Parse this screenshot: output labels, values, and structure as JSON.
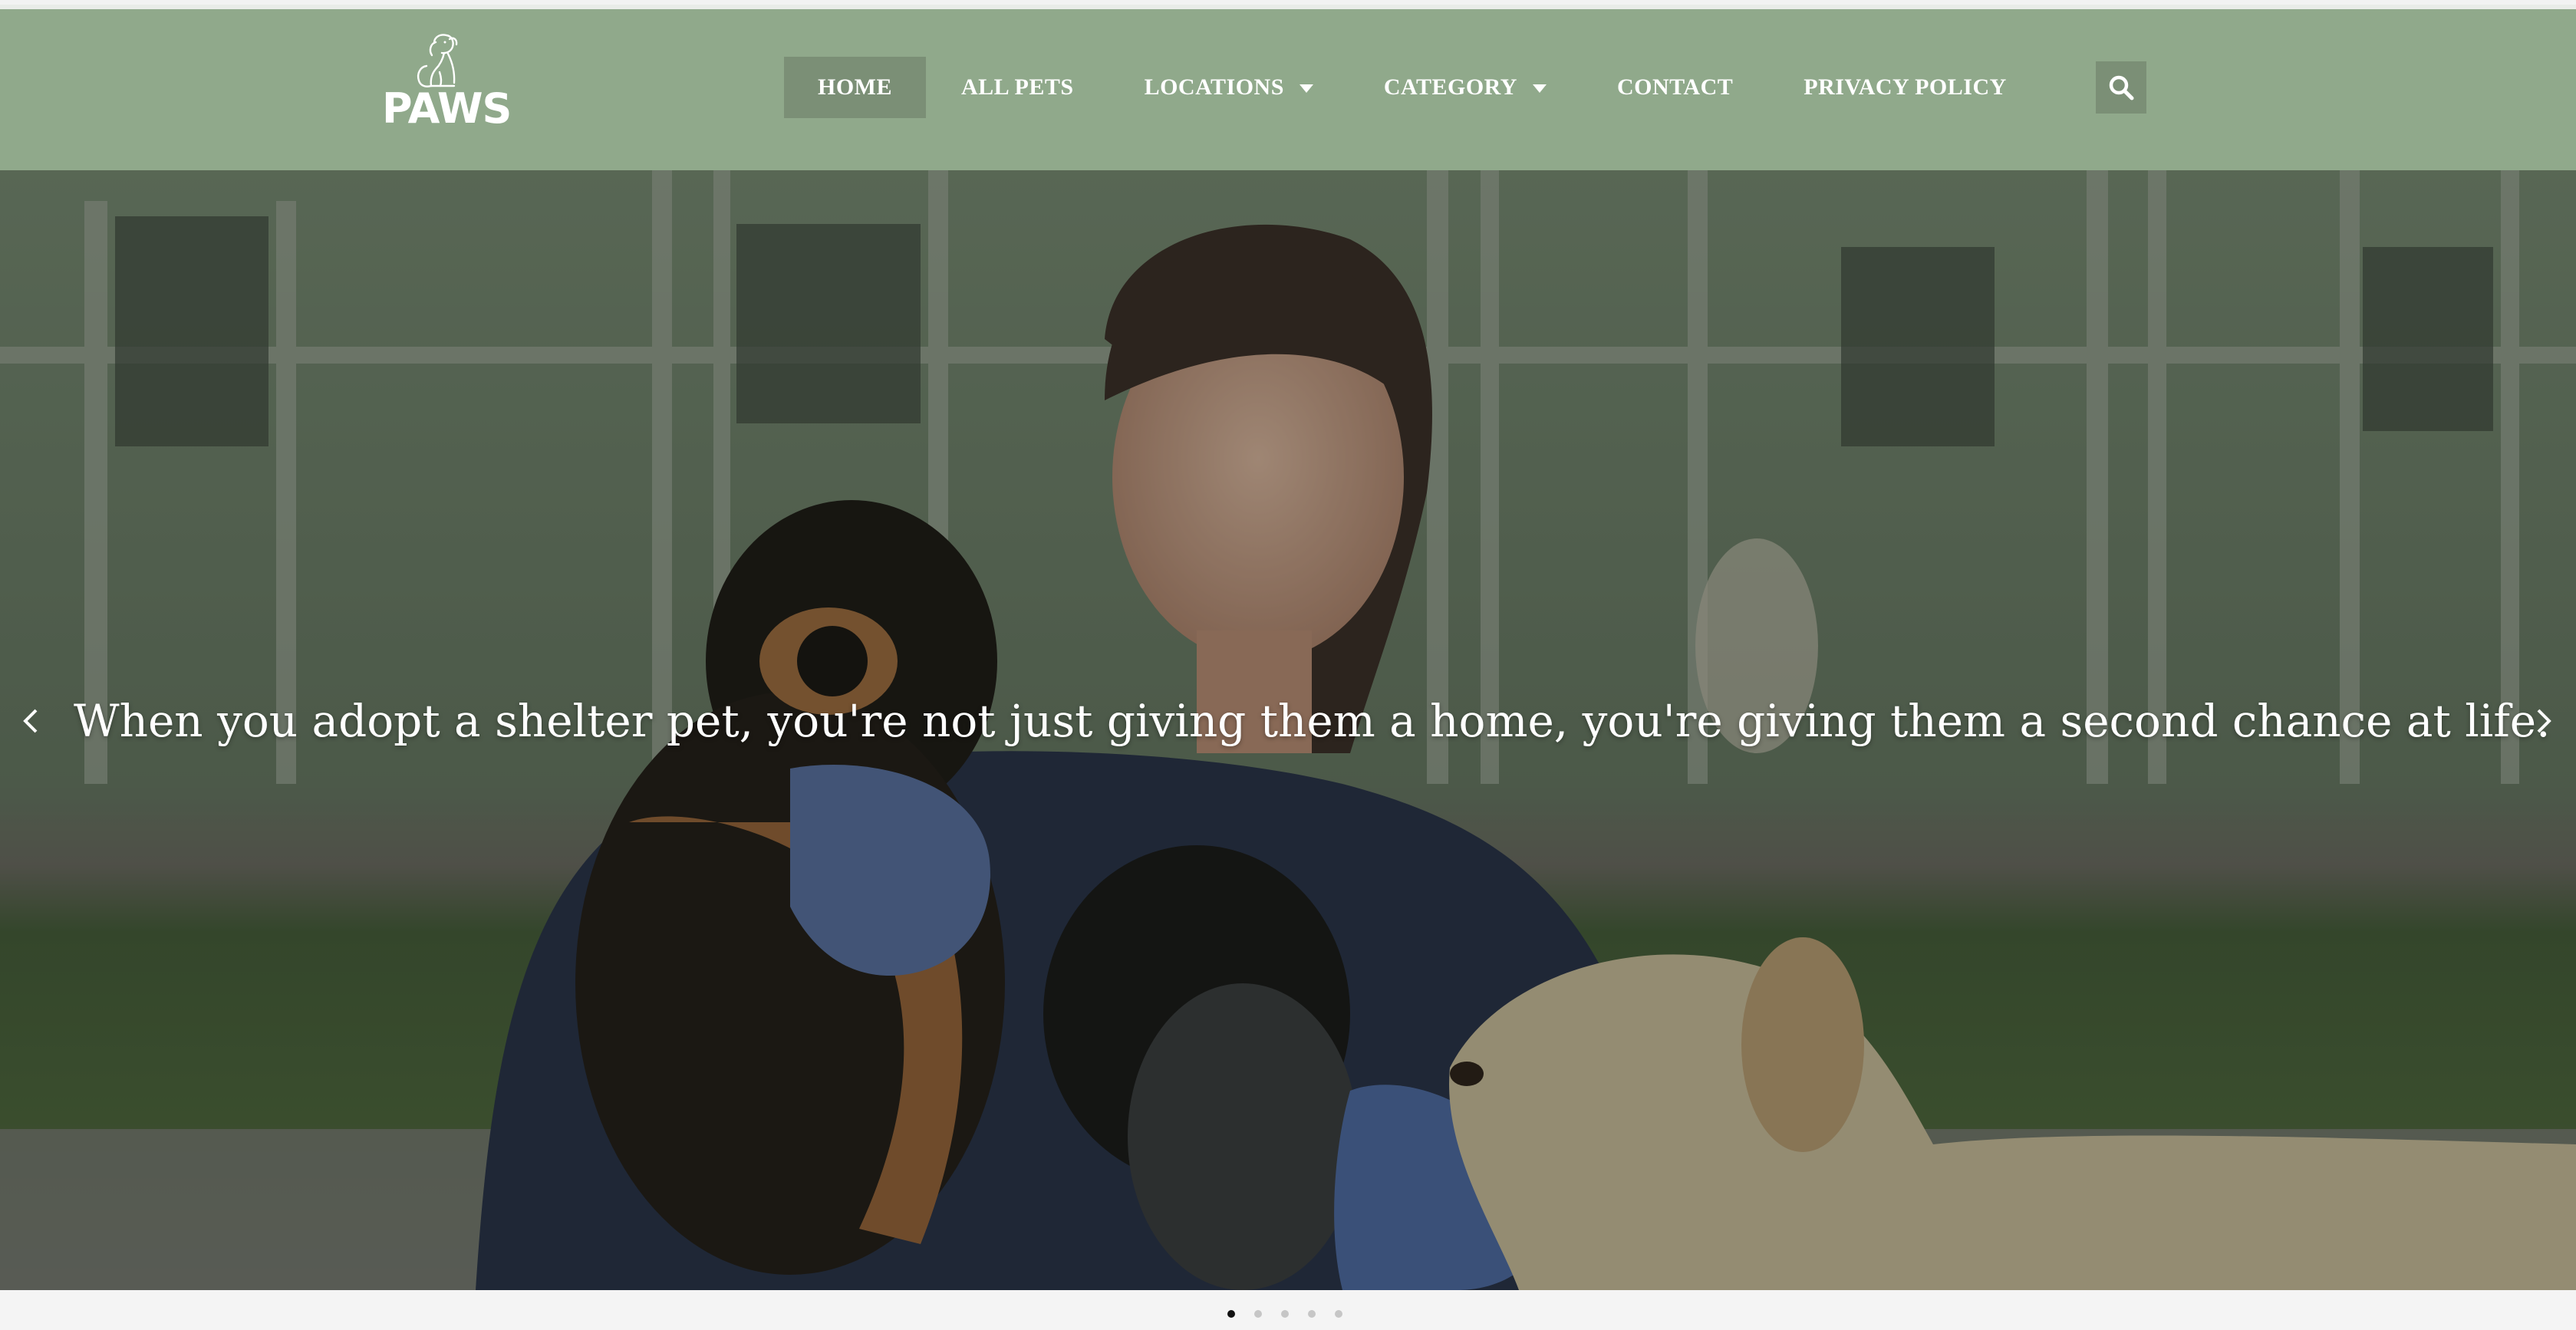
{
  "brand": {
    "logo_text": "PAWS"
  },
  "nav": {
    "items": [
      {
        "label": "HOME",
        "active": true
      },
      {
        "label": "ALL PETS"
      },
      {
        "label": "LOCATIONS",
        "dropdown": true
      },
      {
        "label": "CATEGORY",
        "dropdown": true
      },
      {
        "label": "CONTACT"
      },
      {
        "label": "PRIVACY POLICY"
      }
    ],
    "search_icon": "search-icon"
  },
  "hero": {
    "slide_text": "When you adopt a shelter pet, you're not just giving them a home, you're giving them a second chance at life.",
    "prev_icon": "chevron-left-icon",
    "next_icon": "chevron-right-icon",
    "slide_count": 5,
    "current_slide": 1
  },
  "colors": {
    "header_bg": "#90a98b",
    "nav_active_bg": "#7b8f76",
    "text": "#ffffff"
  }
}
